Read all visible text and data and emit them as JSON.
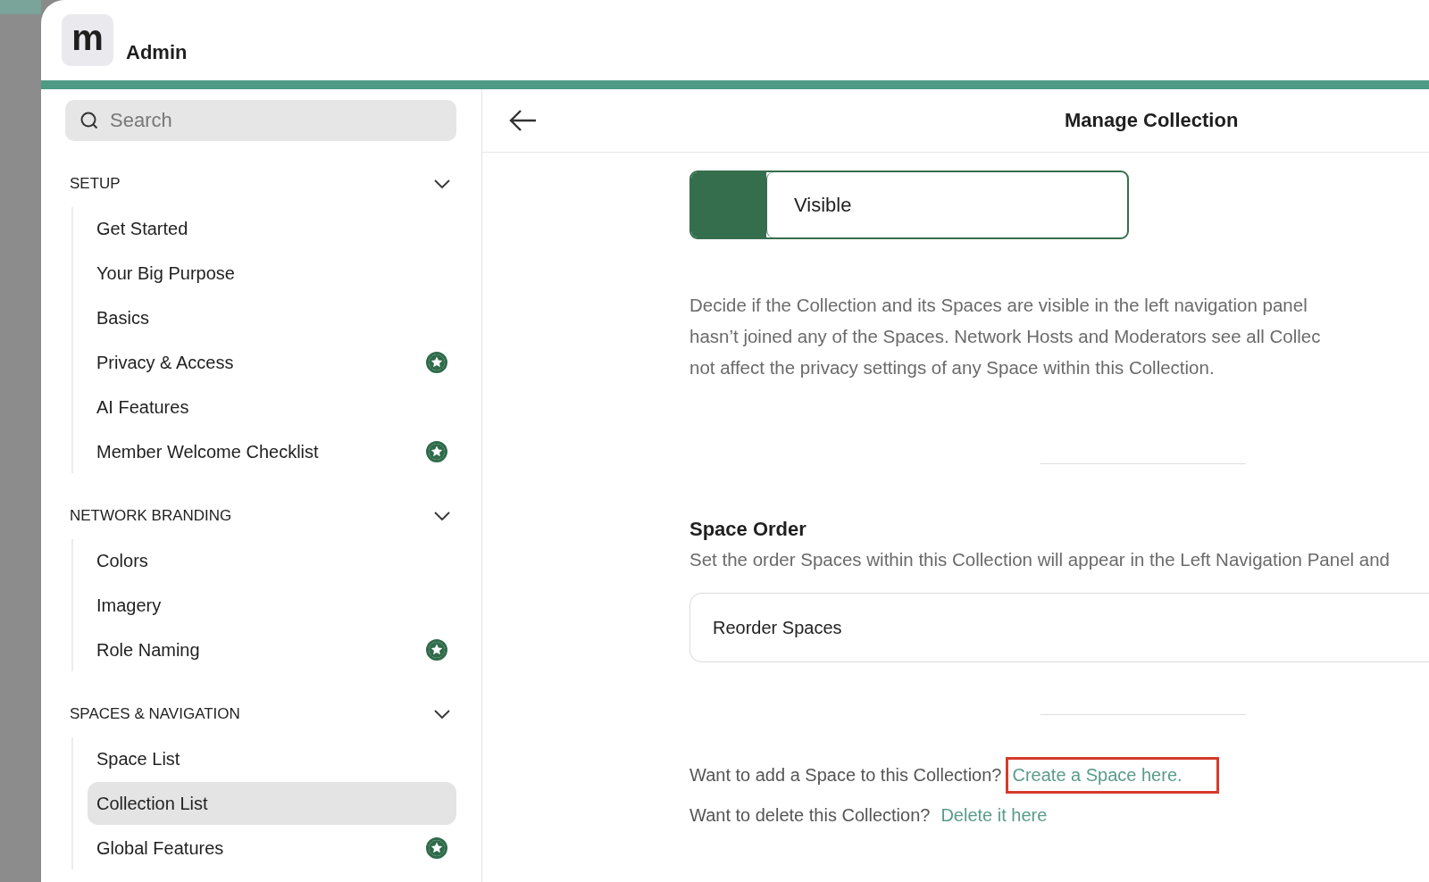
{
  "header": {
    "title": "Admin",
    "logo": "m"
  },
  "sidebar": {
    "search": {
      "placeholder": "Search"
    },
    "sections": [
      {
        "title": "SETUP",
        "expanded": true,
        "items": [
          {
            "label": "Get Started",
            "starred": false,
            "selected": false
          },
          {
            "label": "Your Big Purpose",
            "starred": false,
            "selected": false
          },
          {
            "label": "Basics",
            "starred": false,
            "selected": false
          },
          {
            "label": "Privacy & Access",
            "starred": true,
            "selected": false
          },
          {
            "label": "AI Features",
            "starred": false,
            "selected": false
          },
          {
            "label": "Member Welcome Checklist",
            "starred": true,
            "selected": false
          }
        ]
      },
      {
        "title": "NETWORK BRANDING",
        "expanded": true,
        "items": [
          {
            "label": "Colors",
            "starred": false,
            "selected": false
          },
          {
            "label": "Imagery",
            "starred": false,
            "selected": false
          },
          {
            "label": "Role Naming",
            "starred": true,
            "selected": false
          }
        ]
      },
      {
        "title": "SPACES & NAVIGATION",
        "expanded": true,
        "items": [
          {
            "label": "Space List",
            "starred": false,
            "selected": false
          },
          {
            "label": "Collection List",
            "starred": false,
            "selected": true
          },
          {
            "label": "Global Features",
            "starred": true,
            "selected": false
          }
        ]
      }
    ]
  },
  "main": {
    "title": "Manage Collection",
    "visibility": {
      "label": "Visible",
      "on": true
    },
    "description": [
      "Decide if the Collection and its Spaces are visible in the left navigation panel",
      "hasn’t joined any of the Spaces. Network Hosts and Moderators see all Collec",
      "not affect the privacy settings of any Space within this Collection."
    ],
    "space_order": {
      "title": "Space Order",
      "description": "Set the order Spaces within this Collection will appear in the Left Navigation Panel and",
      "button": "Reorder Spaces"
    },
    "links": [
      {
        "text": "Want to add a Space to this Collection?",
        "link": "Create a Space here.",
        "highlighted": true
      },
      {
        "text": "Want to delete this Collection?",
        "link": "Delete it here",
        "highlighted": false
      }
    ]
  }
}
